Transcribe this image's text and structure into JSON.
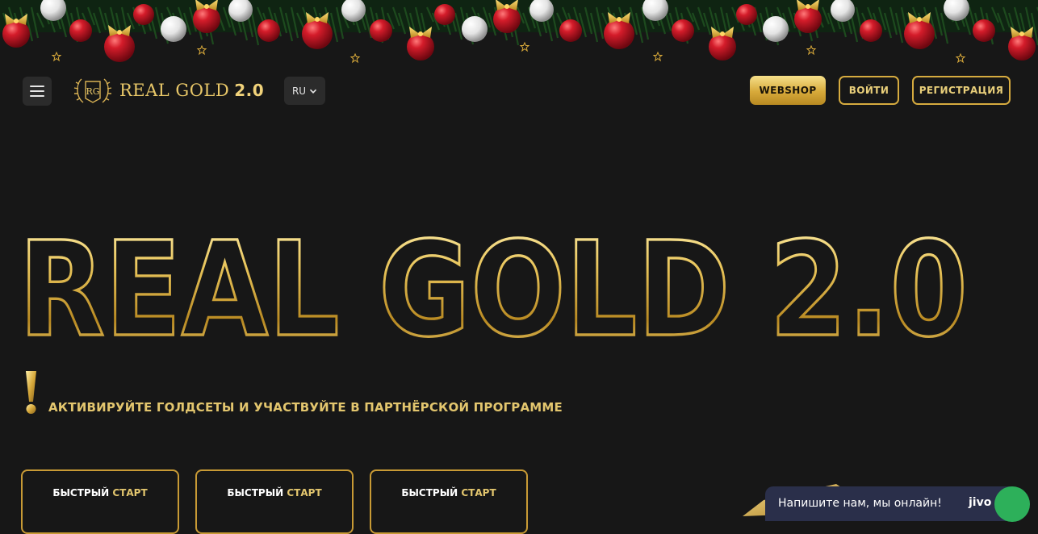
{
  "header": {
    "menu_icon": "hamburger-menu-icon",
    "logo": {
      "monogram": "RG",
      "name": "REAL GOLD",
      "version": "2.0"
    },
    "language": {
      "selected": "RU",
      "icon": "chevron-down-icon"
    },
    "buttons": {
      "webshop": "WEBSHOP",
      "login": "ВОЙТИ",
      "register": "РЕГИСТРАЦИЯ"
    }
  },
  "hero": {
    "title": "REAL GOLD 2.0",
    "tagline": "АКТИВИРУЙТЕ ГОЛДСЕТЫ И УЧАСТВУЙТЕ В ПАРТНЁРСКОЙ ПРОГРАММЕ",
    "tagline_icon": "exclamation-icon"
  },
  "cards": [
    {
      "word1": "БЫСТРЫЙ",
      "word2": "СТАРТ"
    },
    {
      "word1": "БЫСТРЫЙ",
      "word2": "СТАРТ"
    },
    {
      "word1": "БЫСТРЫЙ",
      "word2": "СТАРТ"
    }
  ],
  "chat": {
    "message": "Напишите нам, мы онлайн!",
    "brand": "jivo"
  },
  "colors": {
    "background": "#171717",
    "gold": "#e3c66e",
    "gold_dark": "#c89a35",
    "chat_bg": "#2a2f4a",
    "chat_badge": "#2db05a"
  }
}
